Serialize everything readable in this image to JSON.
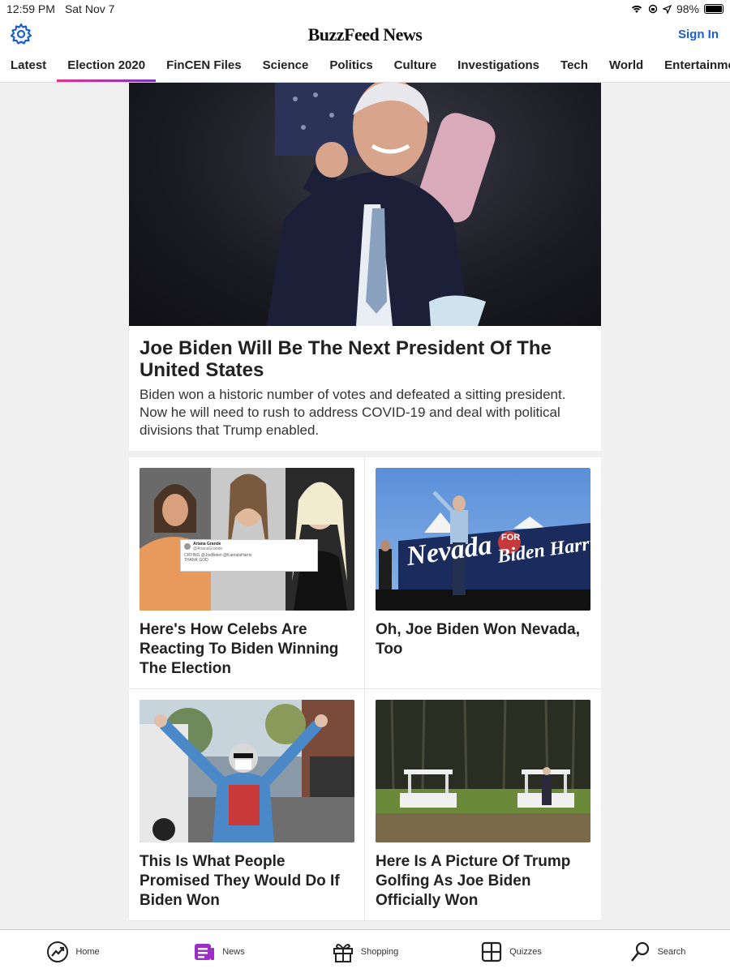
{
  "status": {
    "time": "12:59 PM",
    "date": "Sat Nov 7",
    "battery": "98%",
    "battery_level": 0.98
  },
  "header": {
    "logo": "BuzzFeed News",
    "signin_label": "Sign In"
  },
  "tabs": [
    {
      "label": "Latest",
      "active": false
    },
    {
      "label": "Election 2020",
      "active": true
    },
    {
      "label": "FinCEN Files",
      "active": false
    },
    {
      "label": "Science",
      "active": false
    },
    {
      "label": "Politics",
      "active": false
    },
    {
      "label": "Culture",
      "active": false
    },
    {
      "label": "Investigations",
      "active": false
    },
    {
      "label": "Tech",
      "active": false
    },
    {
      "label": "World",
      "active": false
    },
    {
      "label": "Entertainment",
      "active": false
    }
  ],
  "hero": {
    "title": "Joe Biden Will Be The Next President Of The United States",
    "dek": "Biden won a historic number of votes and defeated a sitting president. Now he will need to rush to address COVID-19 and deal with political divisions that Trump enabled."
  },
  "cards": [
    {
      "title": "Here's How Celebs Are Reacting To Biden Winning The Election",
      "tweet": {
        "name": "Ariana Grande",
        "handle": "@ArianaGrande",
        "line1": "CRYING @JoeBiden @KamalaHarris",
        "line2": "THANK GOD"
      }
    },
    {
      "title": "Oh, Joe Biden Won Nevada, Too",
      "sign": {
        "text1": "Nevada",
        "text2": "FOR",
        "text3": "Biden Harris"
      }
    },
    {
      "title": "This Is What People Promised They Would Do If Biden Won"
    },
    {
      "title": "Here Is A Picture Of Trump Golfing As Joe Biden Officially Won"
    }
  ],
  "bottom_nav": [
    {
      "label": "Home",
      "icon": "trending-icon"
    },
    {
      "label": "News",
      "icon": "news-icon"
    },
    {
      "label": "Shopping",
      "icon": "gift-icon"
    },
    {
      "label": "Quizzes",
      "icon": "quiz-grid-icon"
    },
    {
      "label": "Search",
      "icon": "search-icon"
    }
  ],
  "colors": {
    "accent_blue": "#1a5fd1",
    "tab_gradient_start": "#e0358a",
    "tab_gradient_end": "#7b35c9",
    "news_purple": "#9b2ec7"
  }
}
